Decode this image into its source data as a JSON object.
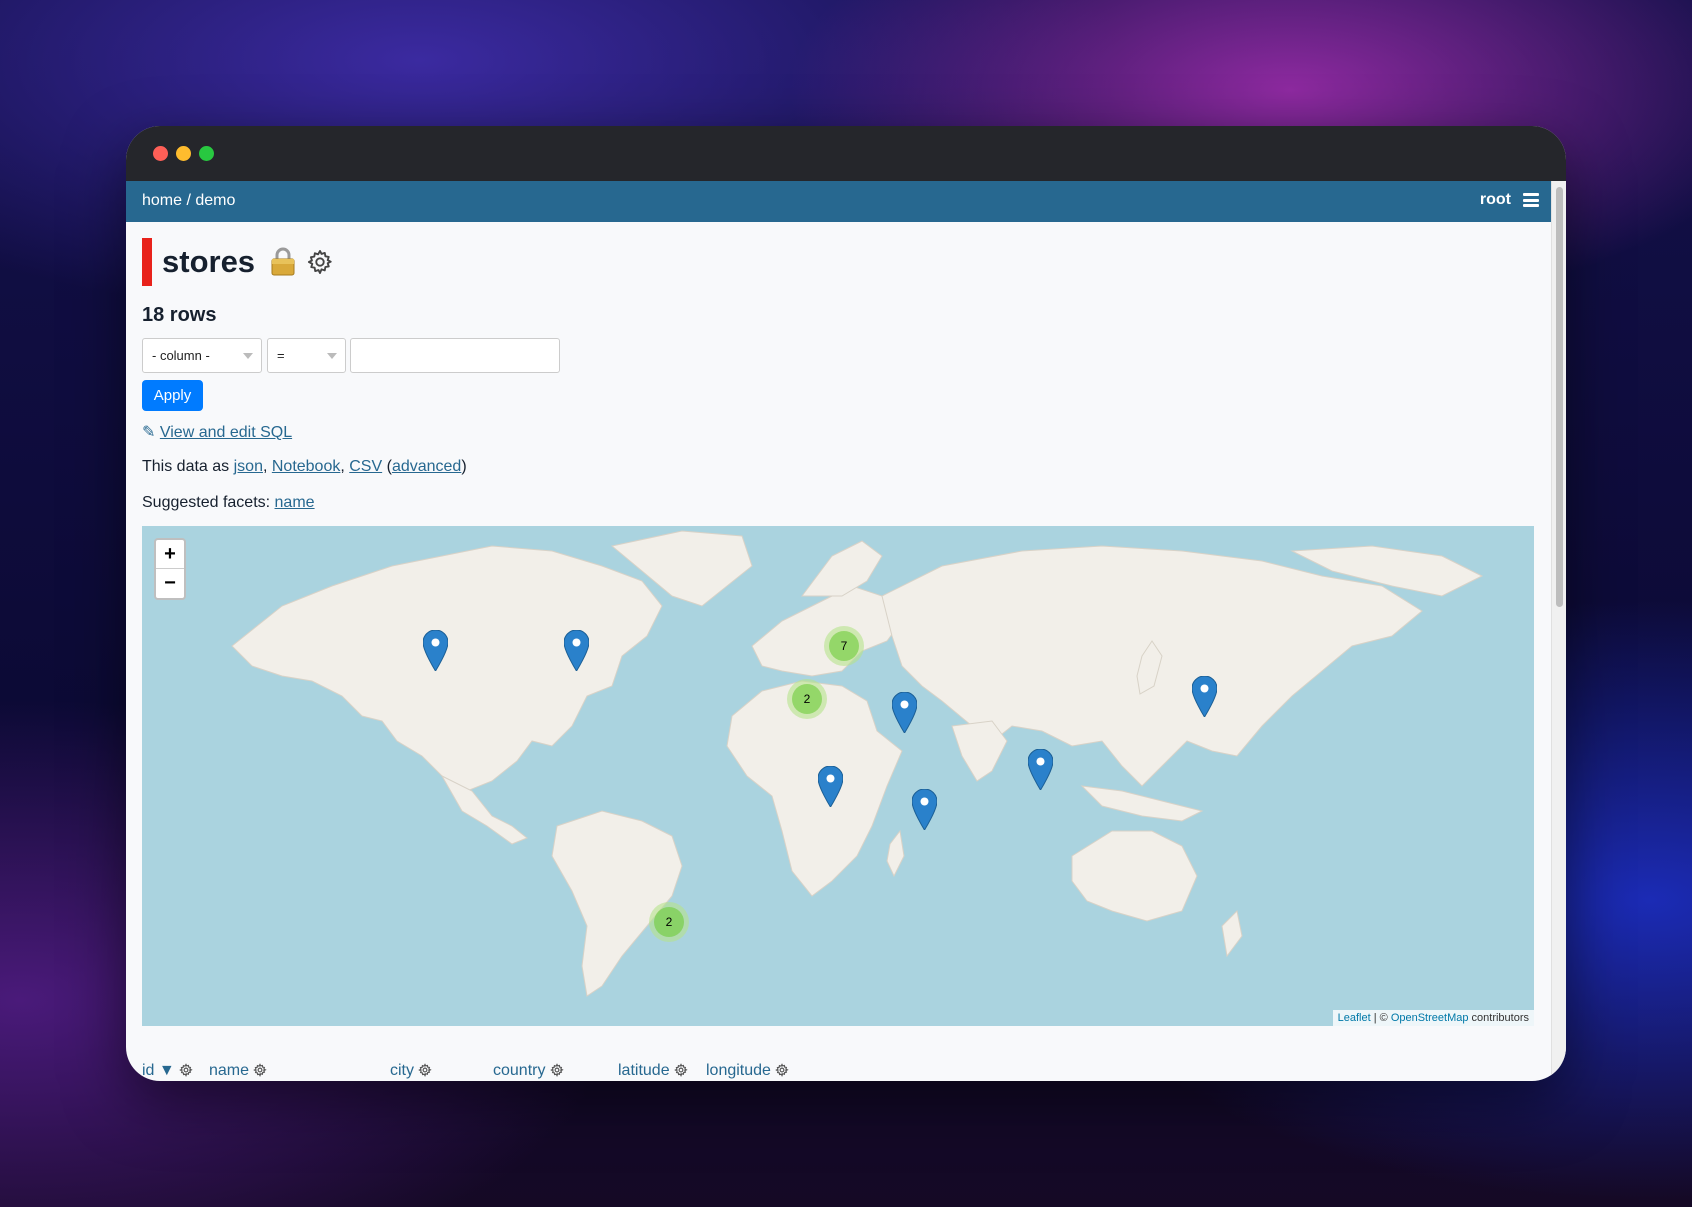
{
  "navbar": {
    "breadcrumb_home": "home",
    "breadcrumb_sep": " / ",
    "breadcrumb_db": "demo",
    "user": "root"
  },
  "page": {
    "title": "stores",
    "row_count": "18 rows"
  },
  "filter": {
    "column_select": "- column -",
    "operator_select": "=",
    "value_input": "",
    "apply_label": "Apply"
  },
  "links": {
    "pencil": "✎",
    "view_sql": "View and edit SQL",
    "data_as_prefix": "This data as ",
    "json": "json",
    "notebook": "Notebook",
    "csv": "CSV",
    "advanced": "advanced",
    "suggested_prefix": "Suggested facets: ",
    "facet_name": "name"
  },
  "map": {
    "zoom_in": "+",
    "zoom_out": "−",
    "attribution_leaflet": "Leaflet",
    "attribution_sep": " | © ",
    "attribution_osm": "OpenStreetMap",
    "attribution_suffix": " contributors",
    "clusters": [
      {
        "label": "7"
      },
      {
        "label": "2"
      },
      {
        "label": "2"
      }
    ],
    "colors": {
      "water": "#aad3df",
      "land": "#f2efe9",
      "marker": "#2a81cb"
    }
  },
  "table": {
    "columns": [
      {
        "label": "id",
        "sort": "▼"
      },
      {
        "label": "name"
      },
      {
        "label": "city"
      },
      {
        "label": "country"
      },
      {
        "label": "latitude"
      },
      {
        "label": "longitude"
      }
    ]
  },
  "colors": {
    "navbar": "#276890",
    "title_bar": "#e8221b",
    "apply": "#007bff"
  }
}
